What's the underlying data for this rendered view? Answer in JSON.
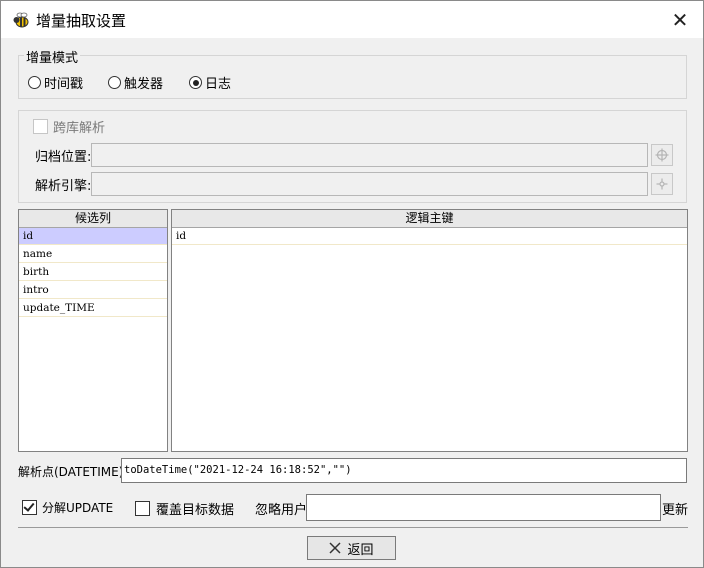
{
  "window": {
    "title": "增量抽取设置",
    "close_glyph": "✕"
  },
  "mode": {
    "legend": "增量模式",
    "options": [
      {
        "label": "时间戳",
        "selected": false
      },
      {
        "label": "触发器",
        "selected": false
      },
      {
        "label": "日志",
        "selected": true
      }
    ]
  },
  "cross_db": {
    "label": "跨库解析",
    "checked": false,
    "enabled": false,
    "archive_label": "归档位置:",
    "archive_value": "",
    "engine_label": "解析引擎:",
    "engine_value": ""
  },
  "candidates": {
    "header": "候选列",
    "items": [
      "id",
      "name",
      "birth",
      "intro",
      "update_TIME"
    ],
    "selected_index": 0
  },
  "logic_keys": {
    "header": "逻辑主键",
    "items": [
      "id"
    ]
  },
  "parse_point": {
    "label": "解析点(DATETIME):",
    "value": "toDateTime(\"2021-12-24 16:18:52\",\"\")"
  },
  "options": {
    "split_update_label": "分解UPDATE",
    "split_update_checked": true,
    "overwrite_label": "覆盖目标数据",
    "overwrite_checked": false,
    "ignore_user_label": "忽略用户",
    "ignore_user_value": "",
    "update_label": "更新"
  },
  "footer": {
    "back_label": "返回",
    "back_icon": "x-icon"
  }
}
